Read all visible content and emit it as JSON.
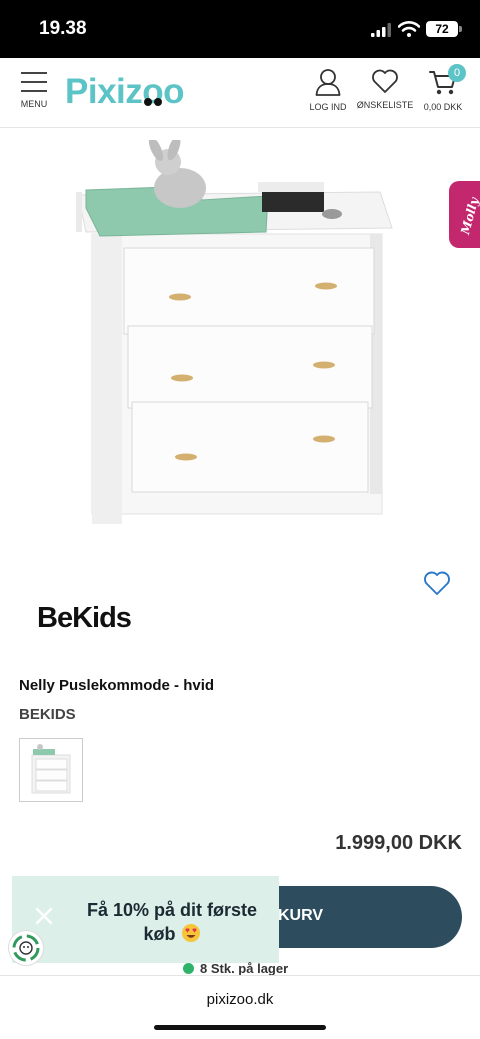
{
  "status_bar": {
    "time": "19.38",
    "battery": "72"
  },
  "header": {
    "menu_label": "MENU",
    "logo_text": "Pixizoo",
    "login_label": "LOG IND",
    "wishlist_label": "ØNSKELISTE",
    "cart_total": "0,00 DKK",
    "cart_count": "0"
  },
  "side_tab": {
    "label": "Molly"
  },
  "product": {
    "brand_logo": "BeKids",
    "title": "Nelly Puslekommode - hvid",
    "brand": "BEKIDS",
    "price": "1.999,00 DKK",
    "add_to_cart_label": "KURV",
    "stock": "8 Stk. på lager"
  },
  "promo": {
    "line1": "Få 10% på dit første",
    "line2": "køb"
  },
  "browser": {
    "url": "pixizoo.dk"
  },
  "colors": {
    "brand": "#5cc3c6",
    "button": "#2d4d5e",
    "promo_bg": "#dcefe8",
    "side_tab": "#c3286f",
    "stock_dot": "#2fb36b"
  }
}
